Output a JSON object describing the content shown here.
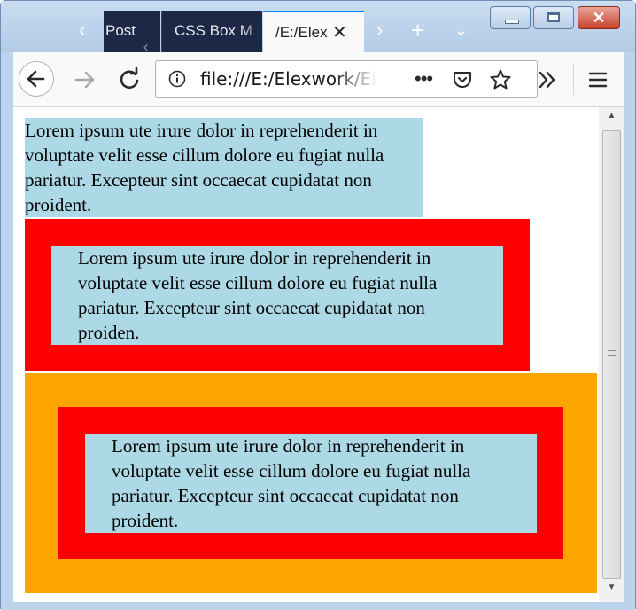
{
  "browser": {
    "tabs": [
      {
        "label": "Post",
        "close_glyph": "‹"
      },
      {
        "label": "CSS Box M"
      },
      {
        "label": "/E:/Elex",
        "close_glyph": "✕"
      }
    ],
    "url": "file:///E:/Elexwork/Ele",
    "accent_color": "#0a84ff"
  },
  "page": {
    "lorem_1": "Lorem ipsum ute irure dolor in reprehenderit in voluptate velit esse cillum dolore eu fugiat nulla pariatur. Excepteur sint occaecat cupidatat non proident.",
    "lorem_2": "Lorem ipsum ute irure dolor in reprehenderit in voluptate velit esse cillum dolore eu fugiat nulla pariatur. Excepteur sint occaecat cupidatat non proiden.",
    "lorem_3": "Lorem ipsum ute irure dolor in reprehenderit in voluptate velit esse cillum dolore eu fugiat nulla pariatur. Excepteur sint occaecat cupidatat non proident.",
    "colors": {
      "lightblue": "#add8e6",
      "red": "#ff0000",
      "orange": "#ffa500"
    }
  }
}
